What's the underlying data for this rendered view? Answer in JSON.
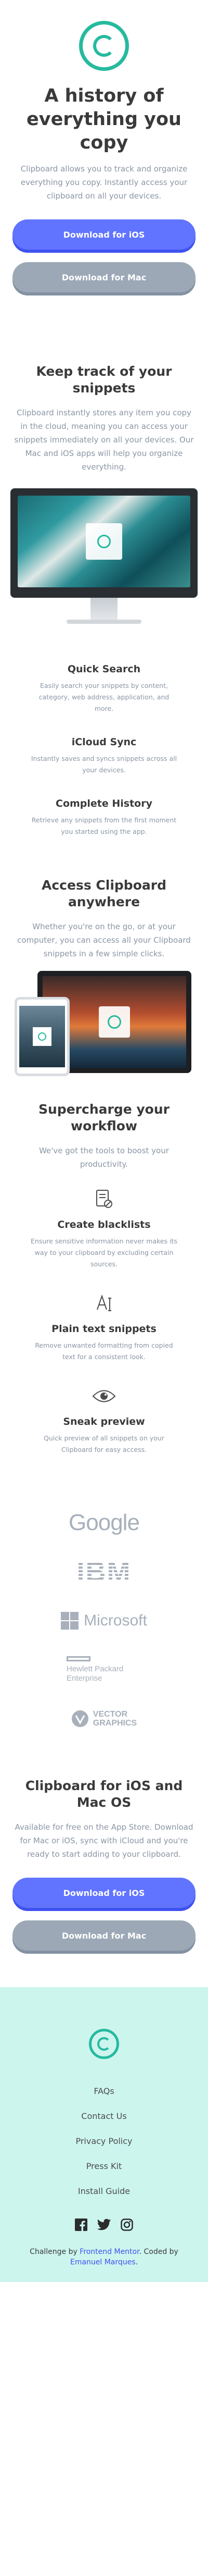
{
  "hero": {
    "title": "A history of everything you copy",
    "subtitle": "Clipboard allows you to track and organize everything you copy. Instantly access your clipboard on all your devices.",
    "ios_button": "Download for iOS",
    "mac_button": "Download for Mac"
  },
  "snippets": {
    "title": "Keep track of your snippets",
    "body": "Clipboard instantly stores any item you copy in the cloud, meaning you can access your snippets immediately on all your devices. Our Mac and iOS apps will help you organize everything.",
    "features": [
      {
        "title": "Quick Search",
        "text": "Easily search your snippets by content, category, web address, application, and more."
      },
      {
        "title": "iCloud Sync",
        "text": "Instantly saves and syncs snippets across all your devices."
      },
      {
        "title": "Complete History",
        "text": "Retrieve any snippets from the first moment you started using the app."
      }
    ]
  },
  "access": {
    "title": "Access Clipboard anywhere",
    "body": "Whether you're on the go, or at your computer, you can access all your Clipboard snippets in a few simple clicks."
  },
  "workflow": {
    "title": "Supercharge your workflow",
    "body": "We've got the tools to boost your productivity.",
    "features": [
      {
        "title": "Create blacklists",
        "text": "Ensure sensitive information never makes its way to your clipboard by excluding certain sources.",
        "icon": "blacklist-icon"
      },
      {
        "title": "Plain text snippets",
        "text": "Remove unwanted formatting from copied text for a consistent look.",
        "icon": "text-icon"
      },
      {
        "title": "Sneak preview",
        "text": "Quick preview of all snippets on your Clipboard for easy access.",
        "icon": "eye-icon"
      }
    ]
  },
  "partners": {
    "google": "Google",
    "ibm": "IBM",
    "microsoft": "Microsoft",
    "hp_line1": "Hewlett Packard",
    "hp_line2": "Enterprise",
    "vector_line1": "VECTOR",
    "vector_line2": "GRAPHICS"
  },
  "cta": {
    "title": "Clipboard for iOS and Mac OS",
    "body": "Available for free on the App Store. Download for Mac or iOS, sync with iCloud and you're ready to start adding to your clipboard.",
    "ios_button": "Download for iOS",
    "mac_button": "Download for Mac"
  },
  "footer": {
    "links": [
      "FAQs",
      "Contact Us",
      "Privacy Policy",
      "Press Kit",
      "Install Guide"
    ],
    "attribution_prefix": "Challenge by ",
    "attribution_fm": "Frontend Mentor",
    "attribution_mid": ". Coded by ",
    "attribution_author": "Emanuel Marques",
    "attribution_end": "."
  },
  "colors": {
    "accent": "#26ba9f",
    "ios_button": "#6174ff",
    "mac_button": "#9ca8b6",
    "footer_bg": "#ccf5ee",
    "link": "#3e52f0"
  }
}
